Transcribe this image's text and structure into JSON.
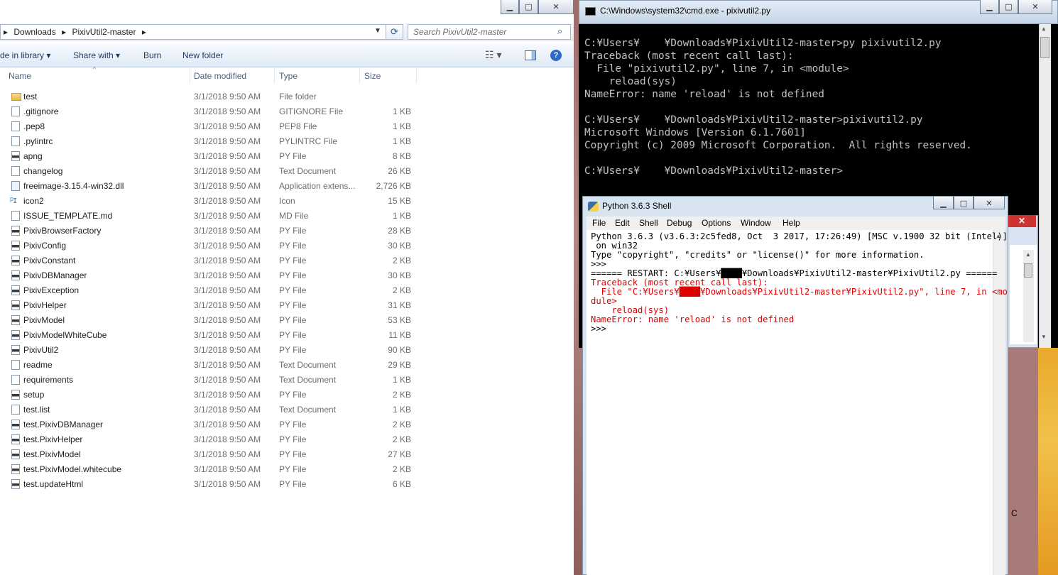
{
  "explorer": {
    "breadcrumb": [
      "Downloads",
      "▸",
      "PixivUtil2-master",
      "▸"
    ],
    "search_placeholder": "Search PixivUtil2-master",
    "toolbar": {
      "include_in_library": "de in library ▾",
      "share_with": "Share with ▾",
      "burn": "Burn",
      "new_folder": "New folder"
    },
    "columns": {
      "name": "Name",
      "date": "Date modified",
      "type": "Type",
      "size": "Size"
    },
    "files": [
      {
        "name": "test",
        "date": "3/1/2018 9:50 AM",
        "type": "File folder",
        "size": "",
        "icon": "folder"
      },
      {
        "name": ".gitignore",
        "date": "3/1/2018 9:50 AM",
        "type": "GITIGNORE File",
        "size": "1 KB",
        "icon": "file"
      },
      {
        "name": ".pep8",
        "date": "3/1/2018 9:50 AM",
        "type": "PEP8 File",
        "size": "1 KB",
        "icon": "file"
      },
      {
        "name": ".pylintrc",
        "date": "3/1/2018 9:50 AM",
        "type": "PYLINTRC File",
        "size": "1 KB",
        "icon": "file"
      },
      {
        "name": "apng",
        "date": "3/1/2018 9:50 AM",
        "type": "PY File",
        "size": "8 KB",
        "icon": "py"
      },
      {
        "name": "changelog",
        "date": "3/1/2018 9:50 AM",
        "type": "Text Document",
        "size": "26 KB",
        "icon": "file"
      },
      {
        "name": "freeimage-3.15.4-win32.dll",
        "date": "3/1/2018 9:50 AM",
        "type": "Application extens...",
        "size": "2,726 KB",
        "icon": "dll"
      },
      {
        "name": "icon2",
        "date": "3/1/2018 9:50 AM",
        "type": "Icon",
        "size": "15 KB",
        "icon": "icon"
      },
      {
        "name": "ISSUE_TEMPLATE.md",
        "date": "3/1/2018 9:50 AM",
        "type": "MD File",
        "size": "1 KB",
        "icon": "file"
      },
      {
        "name": "PixivBrowserFactory",
        "date": "3/1/2018 9:50 AM",
        "type": "PY File",
        "size": "28 KB",
        "icon": "py"
      },
      {
        "name": "PixivConfig",
        "date": "3/1/2018 9:50 AM",
        "type": "PY File",
        "size": "30 KB",
        "icon": "py"
      },
      {
        "name": "PixivConstant",
        "date": "3/1/2018 9:50 AM",
        "type": "PY File",
        "size": "2 KB",
        "icon": "py"
      },
      {
        "name": "PixivDBManager",
        "date": "3/1/2018 9:50 AM",
        "type": "PY File",
        "size": "30 KB",
        "icon": "py"
      },
      {
        "name": "PixivException",
        "date": "3/1/2018 9:50 AM",
        "type": "PY File",
        "size": "2 KB",
        "icon": "py"
      },
      {
        "name": "PixivHelper",
        "date": "3/1/2018 9:50 AM",
        "type": "PY File",
        "size": "31 KB",
        "icon": "py"
      },
      {
        "name": "PixivModel",
        "date": "3/1/2018 9:50 AM",
        "type": "PY File",
        "size": "53 KB",
        "icon": "py"
      },
      {
        "name": "PixivModelWhiteCube",
        "date": "3/1/2018 9:50 AM",
        "type": "PY File",
        "size": "11 KB",
        "icon": "py"
      },
      {
        "name": "PixivUtil2",
        "date": "3/1/2018 9:50 AM",
        "type": "PY File",
        "size": "90 KB",
        "icon": "py"
      },
      {
        "name": "readme",
        "date": "3/1/2018 9:50 AM",
        "type": "Text Document",
        "size": "29 KB",
        "icon": "file"
      },
      {
        "name": "requirements",
        "date": "3/1/2018 9:50 AM",
        "type": "Text Document",
        "size": "1 KB",
        "icon": "file"
      },
      {
        "name": "setup",
        "date": "3/1/2018 9:50 AM",
        "type": "PY File",
        "size": "2 KB",
        "icon": "py"
      },
      {
        "name": "test.list",
        "date": "3/1/2018 9:50 AM",
        "type": "Text Document",
        "size": "1 KB",
        "icon": "file"
      },
      {
        "name": "test.PixivDBManager",
        "date": "3/1/2018 9:50 AM",
        "type": "PY File",
        "size": "2 KB",
        "icon": "py"
      },
      {
        "name": "test.PixivHelper",
        "date": "3/1/2018 9:50 AM",
        "type": "PY File",
        "size": "2 KB",
        "icon": "py"
      },
      {
        "name": "test.PixivModel",
        "date": "3/1/2018 9:50 AM",
        "type": "PY File",
        "size": "27 KB",
        "icon": "py"
      },
      {
        "name": "test.PixivModel.whitecube",
        "date": "3/1/2018 9:50 AM",
        "type": "PY File",
        "size": "2 KB",
        "icon": "py"
      },
      {
        "name": "test.updateHtml",
        "date": "3/1/2018 9:50 AM",
        "type": "PY File",
        "size": "6 KB",
        "icon": "py"
      }
    ]
  },
  "cmd": {
    "title": "C:\\Windows\\system32\\cmd.exe - pixivutil2.py",
    "lines": [
      "C:¥Users¥    ¥Downloads¥PixivUtil2-master>py pixivutil2.py",
      "Traceback (most recent call last):",
      "  File \"pixivutil2.py\", line 7, in <module>",
      "    reload(sys)",
      "NameError: name 'reload' is not defined",
      "",
      "C:¥Users¥    ¥Downloads¥PixivUtil2-master>pixivutil2.py",
      "Microsoft Windows [Version 6.1.7601]",
      "Copyright (c) 2009 Microsoft Corporation.  All rights reserved.",
      "",
      "C:¥Users¥    ¥Downloads¥PixivUtil2-master>"
    ]
  },
  "idle": {
    "title": "Python 3.6.3 Shell",
    "menu": [
      "File",
      "Edit",
      "Shell",
      "Debug",
      "Options",
      "Window",
      "Help"
    ],
    "lines": [
      {
        "text": "Python 3.6.3 (v3.6.3:2c5fed8, Oct  3 2017, 17:26:49) [MSC v.1900 32 bit (Intel)]",
        "color": "black"
      },
      {
        "text": " on win32",
        "color": "black"
      },
      {
        "text": "Type \"copyright\", \"credits\" or \"license()\" for more information.",
        "color": "black"
      },
      {
        "text": ">>> ",
        "color": "black"
      },
      {
        "text": "====== RESTART: C:¥Users¥████¥Downloads¥PixivUtil2-master¥PixivUtil2.py ======",
        "color": "black"
      },
      {
        "text": "Traceback (most recent call last):",
        "color": "red"
      },
      {
        "text": "  File \"C:¥Users¥████¥Downloads¥PixivUtil2-master¥PixivUtil2.py\", line 7, in <mo",
        "color": "red"
      },
      {
        "text": "dule>",
        "color": "red"
      },
      {
        "text": "    reload(sys)",
        "color": "red"
      },
      {
        "text": "NameError: name 'reload' is not defined",
        "color": "red"
      },
      {
        "text": ">>> ",
        "color": "black"
      }
    ],
    "back_close": "✕",
    "side_char": "C"
  },
  "window_buttons": {
    "minimize": "▁",
    "maximize": "□",
    "close": "✕"
  }
}
